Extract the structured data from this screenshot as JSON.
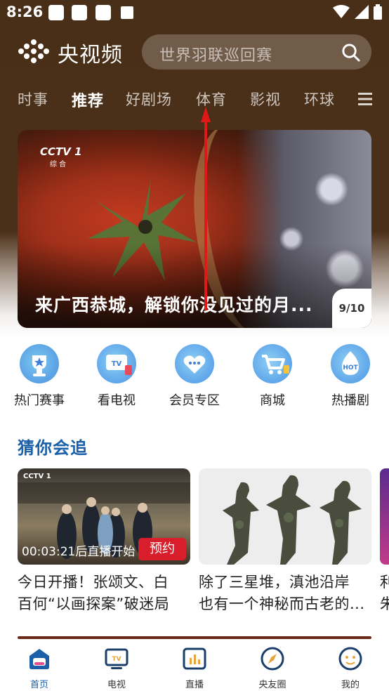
{
  "status_bar": {
    "time": "8:26"
  },
  "header": {
    "brand": "央视频",
    "search_placeholder": "世界羽联巡回赛"
  },
  "tabs": [
    {
      "label": "时事"
    },
    {
      "label": "推荐",
      "active": true
    },
    {
      "label": "好剧场"
    },
    {
      "label": "体育"
    },
    {
      "label": "影视"
    },
    {
      "label": "环球"
    }
  ],
  "banner": {
    "channel": "CCTV 1",
    "channel_sub": "综 合",
    "title": "来广西恭城，解锁你没见过的月...",
    "pager": "9/10"
  },
  "quick_entries": [
    {
      "label": "热门赛事",
      "icon": "trophy-icon"
    },
    {
      "label": "看电视",
      "icon": "tv-icon"
    },
    {
      "label": "会员专区",
      "icon": "vip-heart-icon"
    },
    {
      "label": "商城",
      "icon": "cart-icon"
    },
    {
      "label": "热播剧",
      "icon": "hot-icon"
    }
  ],
  "section": {
    "title": "猜你会追"
  },
  "cards": [
    {
      "line1": "今日开播！张颂文、白",
      "line2": "百何“以画探案”破迷局",
      "countdown": "00:03:21后直播开始",
      "action": "预约",
      "thumb_tag": "CCTV 1"
    },
    {
      "line1": "除了三星堆，滇池沿岸",
      "line2": "也有一个神秘而古老的..."
    }
  ],
  "peek_card": {
    "line1": "利",
    "line2": "朱"
  },
  "bottom_nav": [
    {
      "label": "首页",
      "icon": "home-icon",
      "active": true
    },
    {
      "label": "电视",
      "icon": "tv-icon"
    },
    {
      "label": "直播",
      "icon": "live-icon"
    },
    {
      "label": "央友圈",
      "icon": "compass-icon"
    },
    {
      "label": "我的",
      "icon": "profile-icon"
    }
  ],
  "colors": {
    "accent": "#1a5fa8",
    "header_bg": "#4a2f18",
    "reserve_red": "#d81e2a"
  }
}
